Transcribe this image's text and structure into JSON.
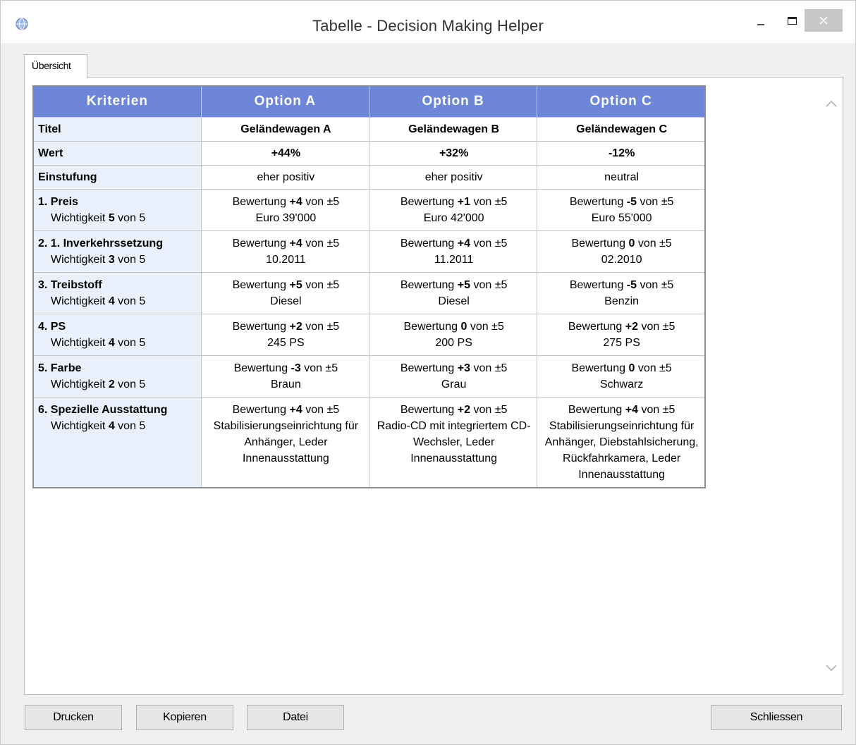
{
  "window": {
    "title": "Tabelle - Decision Making Helper"
  },
  "tabs": [
    {
      "label": "Übersicht"
    }
  ],
  "table": {
    "headers": [
      "Kriterien",
      "Option A",
      "Option B",
      "Option C"
    ],
    "titel": {
      "label": "Titel",
      "values": [
        "Geländewagen A",
        "Geländewagen B",
        "Geländewagen C"
      ]
    },
    "wert": {
      "label": "Wert",
      "values": [
        "+44%",
        "+32%",
        "-12%"
      ]
    },
    "einstufung": {
      "label": "Einstufung",
      "values": [
        "eher positiv",
        "eher positiv",
        "neutral"
      ]
    },
    "rating_prefix": "Bewertung",
    "rating_suffix": "von ±5",
    "importance_prefix": "Wichtigkeit",
    "importance_suffix": "von 5",
    "criteria": [
      {
        "name": "1. Preis",
        "importance": "5",
        "options": [
          {
            "score": "+4",
            "detail": "Euro 39'000"
          },
          {
            "score": "+1",
            "detail": "Euro 42'000"
          },
          {
            "score": "-5",
            "detail": "Euro 55'000"
          }
        ]
      },
      {
        "name": "2. 1. Inverkehrssetzung",
        "importance": "3",
        "options": [
          {
            "score": "+4",
            "detail": "10.2011"
          },
          {
            "score": "+4",
            "detail": "11.2011"
          },
          {
            "score": "0",
            "detail": "02.2010"
          }
        ]
      },
      {
        "name": "3. Treibstoff",
        "importance": "4",
        "options": [
          {
            "score": "+5",
            "detail": "Diesel"
          },
          {
            "score": "+5",
            "detail": "Diesel"
          },
          {
            "score": "-5",
            "detail": "Benzin"
          }
        ]
      },
      {
        "name": "4. PS",
        "importance": "4",
        "options": [
          {
            "score": "+2",
            "detail": "245 PS"
          },
          {
            "score": "0",
            "detail": "200 PS"
          },
          {
            "score": "+2",
            "detail": "275 PS"
          }
        ]
      },
      {
        "name": "5. Farbe",
        "importance": "2",
        "options": [
          {
            "score": "-3",
            "detail": "Braun"
          },
          {
            "score": "+3",
            "detail": "Grau"
          },
          {
            "score": "0",
            "detail": "Schwarz"
          }
        ]
      },
      {
        "name": "6. Spezielle Ausstattung",
        "importance": "4",
        "options": [
          {
            "score": "+4",
            "detail": "Stabilisierungseinrichtung für Anhänger, Leder Innenausstattung"
          },
          {
            "score": "+2",
            "detail": "Radio-CD mit integriertem CD-Wechsler, Leder Innenausstattung"
          },
          {
            "score": "+4",
            "detail": "Stabilisierungseinrichtung für Anhänger, Diebstahlsicherung, Rückfahrkamera, Leder Innenausstattung"
          }
        ]
      }
    ]
  },
  "buttons": {
    "print": "Drucken",
    "copy": "Kopieren",
    "file": "Datei",
    "close": "Schliessen"
  },
  "colors": {
    "header_bg": "#6e86d8",
    "criteria_bg": "#e9f0fb",
    "close_button_bg": "#c7c7c7"
  },
  "icons": {
    "app": "globe-icon",
    "minimize": "minimize-icon",
    "maximize": "maximize-icon",
    "close": "close-icon",
    "scroll_up": "chevron-up-icon",
    "scroll_down": "chevron-down-icon"
  }
}
